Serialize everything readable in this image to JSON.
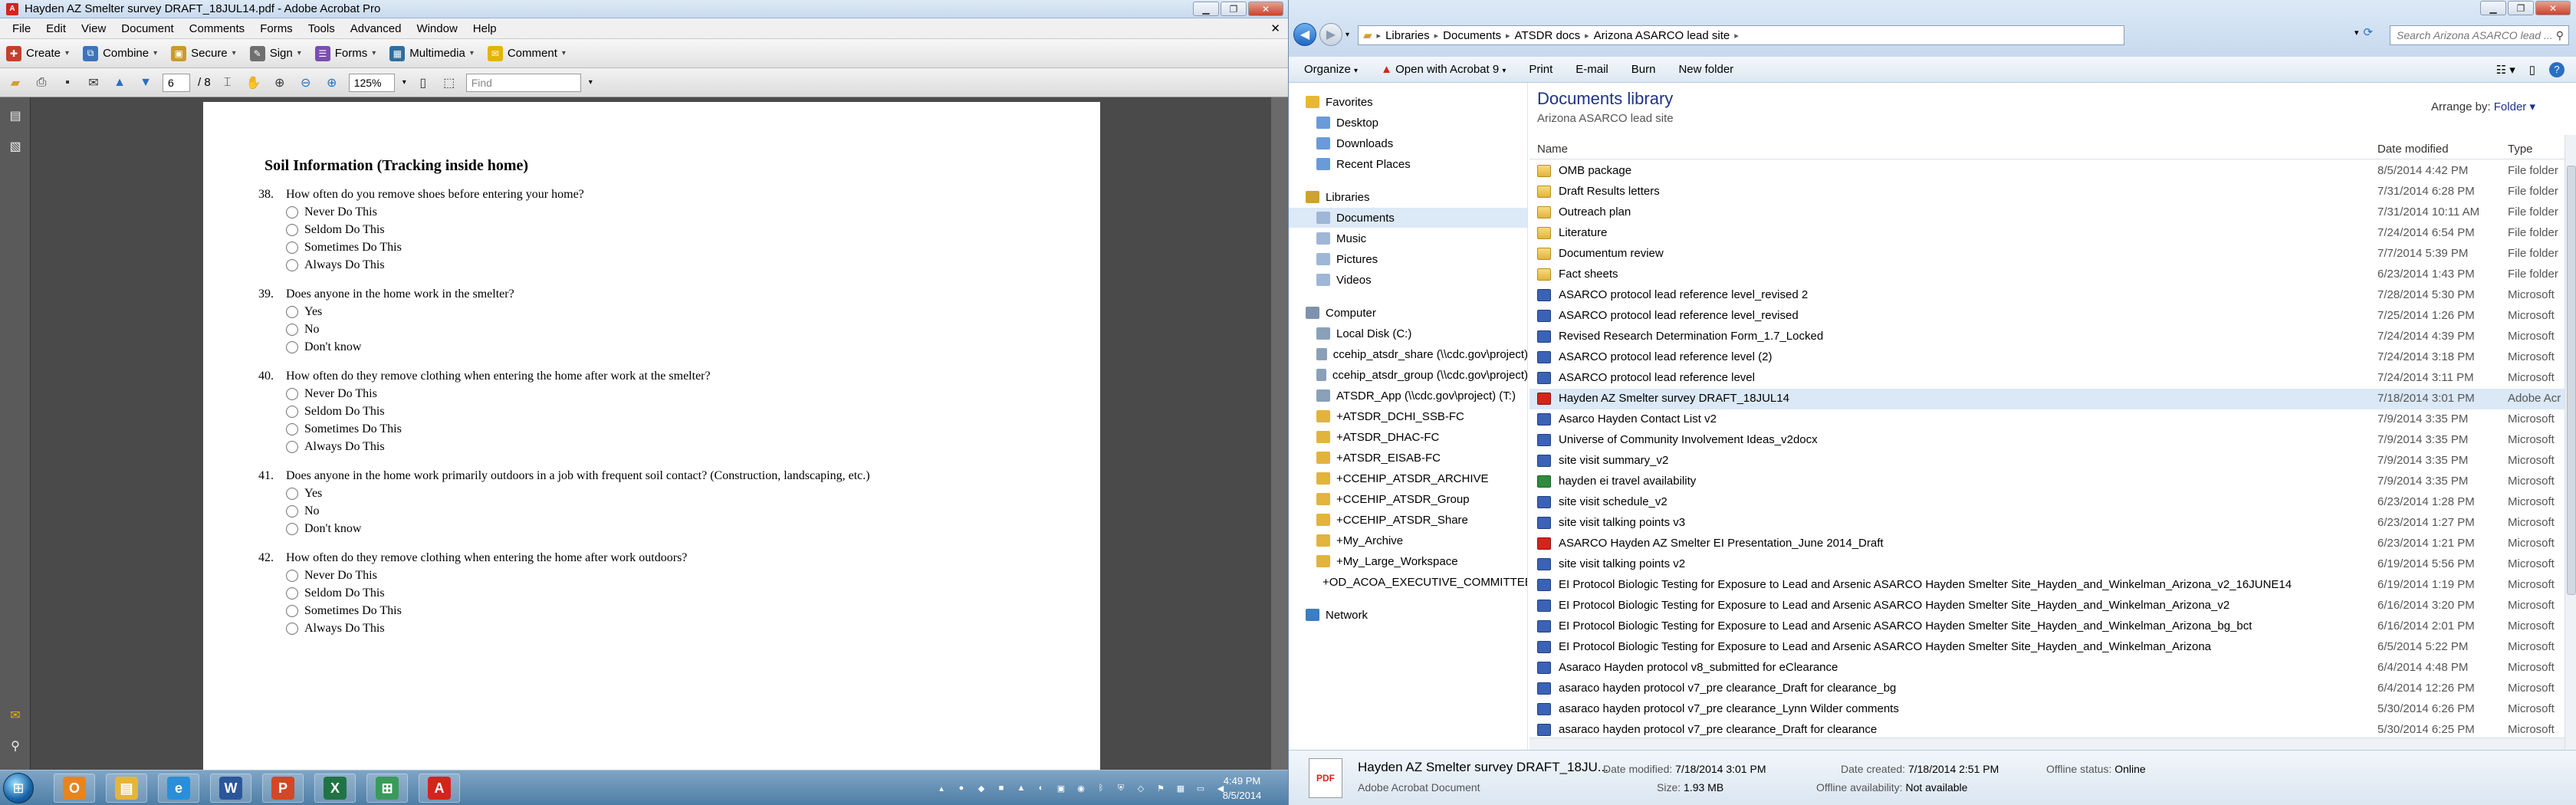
{
  "acrobat": {
    "title": "Hayden AZ Smelter survey DRAFT_18JUL14.pdf - Adobe Acrobat Pro",
    "menu": [
      "File",
      "Edit",
      "View",
      "Document",
      "Comments",
      "Forms",
      "Tools",
      "Advanced",
      "Window",
      "Help"
    ],
    "toolbar1": {
      "create": "Create",
      "combine": "Combine",
      "secure": "Secure",
      "sign": "Sign",
      "forms": "Forms",
      "multimedia": "Multimedia",
      "comment": "Comment"
    },
    "toolbar2": {
      "page": "6",
      "page_total": "/ 8",
      "zoom": "125%",
      "find_placeholder": "Find"
    },
    "document": {
      "heading": "Soil Information (Tracking inside home)",
      "questions": [
        {
          "num": "38.",
          "text": "How often do you remove shoes before entering your home?",
          "options": [
            "Never Do This",
            "Seldom Do This",
            "Sometimes Do This",
            "Always Do This"
          ]
        },
        {
          "num": "39.",
          "text": "Does anyone in the home work in the smelter?",
          "options": [
            "Yes",
            "No",
            "Don't know"
          ]
        },
        {
          "num": "40.",
          "text": "How often do they remove clothing when entering the home after work at the smelter?",
          "options": [
            "Never Do This",
            "Seldom Do This",
            "Sometimes Do This",
            "Always Do This"
          ]
        },
        {
          "num": "41.",
          "text": "Does anyone in the home work primarily outdoors in a job with frequent soil contact? (Construction, landscaping, etc.)",
          "options": [
            "Yes",
            "No",
            "Don't know"
          ]
        },
        {
          "num": "42.",
          "text": "How often do they remove clothing when entering the home after work outdoors?",
          "options": [
            "Never Do This",
            "Seldom Do This",
            "Sometimes Do This",
            "Always Do This"
          ]
        }
      ]
    }
  },
  "taskbar": {
    "apps": [
      {
        "name": "outlook",
        "glyph": "O",
        "color": "#e8841c"
      },
      {
        "name": "explorer",
        "glyph": "▤",
        "color": "#e3b63b"
      },
      {
        "name": "ie",
        "glyph": "e",
        "color": "#2a8fd8"
      },
      {
        "name": "word",
        "glyph": "W",
        "color": "#2b579a"
      },
      {
        "name": "powerpoint",
        "glyph": "P",
        "color": "#d24726"
      },
      {
        "name": "excel",
        "glyph": "X",
        "color": "#217346"
      },
      {
        "name": "network",
        "glyph": "⊞",
        "color": "#3a9a5b"
      },
      {
        "name": "acrobat",
        "glyph": "A",
        "color": "#d4241c"
      }
    ],
    "clock": {
      "time": "4:49 PM",
      "date": "8/5/2014"
    }
  },
  "explorer": {
    "address": [
      "Libraries",
      "Documents",
      "ATSDR docs",
      "Arizona ASARCO lead site"
    ],
    "search_placeholder": "Search Arizona ASARCO lead ...",
    "commands": {
      "organize": "Organize",
      "open_with": "Open with Acrobat 9",
      "print": "Print",
      "email": "E-mail",
      "burn": "Burn",
      "new_folder": "New folder"
    },
    "nav": {
      "favorites_header": "Favorites",
      "favorites": [
        "Desktop",
        "Downloads",
        "Recent Places"
      ],
      "libraries_header": "Libraries",
      "libraries": [
        "Documents",
        "Music",
        "Pictures",
        "Videos"
      ],
      "computer_header": "Computer",
      "computer": [
        "Local Disk (C:)",
        "ccehip_atsdr_share (\\\\cdc.gov\\project)",
        "ccehip_atsdr_group (\\\\cdc.gov\\project)",
        "ATSDR_App (\\\\cdc.gov\\project) (T:)",
        "+ATSDR_DCHI_SSB-FC",
        "+ATSDR_DHAC-FC",
        "+ATSDR_EISAB-FC",
        "+CCEHIP_ATSDR_ARCHIVE",
        "+CCEHIP_ATSDR_Group",
        "+CCEHIP_ATSDR_Share",
        "+My_Archive",
        "+My_Large_Workspace",
        "+OD_ACOA_EXECUTIVE_COMMITTEE-"
      ],
      "network_header": "Network"
    },
    "library": {
      "title": "Documents library",
      "subtitle": "Arizona ASARCO lead site",
      "arrange_label": "Arrange by:",
      "arrange_value": "Folder"
    },
    "columns": {
      "name": "Name",
      "date": "Date modified",
      "type": "Type"
    },
    "files": [
      {
        "name": "OMB package",
        "date": "8/5/2014 4:42 PM",
        "type": "File folder",
        "kind": "folder"
      },
      {
        "name": "Draft Results letters",
        "date": "7/31/2014 6:28 PM",
        "type": "File folder",
        "kind": "folder"
      },
      {
        "name": "Outreach plan",
        "date": "7/31/2014 10:11 AM",
        "type": "File folder",
        "kind": "folder"
      },
      {
        "name": "Literature",
        "date": "7/24/2014 6:54 PM",
        "type": "File folder",
        "kind": "folder"
      },
      {
        "name": "Documentum review",
        "date": "7/7/2014 5:39 PM",
        "type": "File folder",
        "kind": "folder"
      },
      {
        "name": "Fact sheets",
        "date": "6/23/2014 1:43 PM",
        "type": "File folder",
        "kind": "folder"
      },
      {
        "name": "ASARCO protocol lead reference level_revised 2",
        "date": "7/28/2014 5:30 PM",
        "type": "Microsoft",
        "kind": "word"
      },
      {
        "name": "ASARCO protocol lead reference level_revised",
        "date": "7/25/2014 1:26 PM",
        "type": "Microsoft",
        "kind": "word"
      },
      {
        "name": "Revised Research Determination Form_1.7_Locked",
        "date": "7/24/2014 4:39 PM",
        "type": "Microsoft",
        "kind": "word"
      },
      {
        "name": "ASARCO protocol lead reference level (2)",
        "date": "7/24/2014 3:18 PM",
        "type": "Microsoft",
        "kind": "word"
      },
      {
        "name": "ASARCO protocol lead reference level",
        "date": "7/24/2014 3:11 PM",
        "type": "Microsoft",
        "kind": "word"
      },
      {
        "name": "Hayden AZ Smelter survey DRAFT_18JUL14",
        "date": "7/18/2014 3:01 PM",
        "type": "Adobe Acr",
        "kind": "pdf",
        "selected": true
      },
      {
        "name": "Asarco Hayden Contact List v2",
        "date": "7/9/2014 3:35 PM",
        "type": "Microsoft",
        "kind": "word"
      },
      {
        "name": "Universe of Community Involvement Ideas_v2docx",
        "date": "7/9/2014 3:35 PM",
        "type": "Microsoft",
        "kind": "word"
      },
      {
        "name": "site visit summary_v2",
        "date": "7/9/2014 3:35 PM",
        "type": "Microsoft",
        "kind": "word"
      },
      {
        "name": "hayden ei travel availability",
        "date": "7/9/2014 3:35 PM",
        "type": "Microsoft",
        "kind": "excel"
      },
      {
        "name": "site visit schedule_v2",
        "date": "6/23/2014 1:28 PM",
        "type": "Microsoft",
        "kind": "word"
      },
      {
        "name": "site visit talking points v3",
        "date": "6/23/2014 1:27 PM",
        "type": "Microsoft",
        "kind": "word"
      },
      {
        "name": "ASARCO Hayden AZ Smelter EI Presentation_June 2014_Draft",
        "date": "6/23/2014 1:21 PM",
        "type": "Microsoft",
        "kind": "pdf"
      },
      {
        "name": "site visit talking points v2",
        "date": "6/19/2014 5:56 PM",
        "type": "Microsoft",
        "kind": "word"
      },
      {
        "name": "EI Protocol Biologic Testing for Exposure to Lead and Arsenic ASARCO Hayden Smelter Site_Hayden_and_Winkelman_Arizona_v2_16JUNE14",
        "date": "6/19/2014 1:19 PM",
        "type": "Microsoft",
        "kind": "word"
      },
      {
        "name": "EI Protocol Biologic Testing for Exposure to Lead and Arsenic ASARCO Hayden Smelter Site_Hayden_and_Winkelman_Arizona_v2",
        "date": "6/16/2014 3:20 PM",
        "type": "Microsoft",
        "kind": "word"
      },
      {
        "name": "EI Protocol Biologic Testing for Exposure to Lead and Arsenic ASARCO Hayden Smelter Site_Hayden_and_Winkelman_Arizona_bg_bct",
        "date": "6/16/2014 2:01 PM",
        "type": "Microsoft",
        "kind": "word"
      },
      {
        "name": "EI Protocol Biologic Testing for Exposure to Lead and Arsenic ASARCO Hayden Smelter Site_Hayden_and_Winkelman_Arizona",
        "date": "6/5/2014 5:22 PM",
        "type": "Microsoft",
        "kind": "word"
      },
      {
        "name": "Asaraco Hayden protocol v8_submitted for eClearance",
        "date": "6/4/2014 4:48 PM",
        "type": "Microsoft",
        "kind": "word"
      },
      {
        "name": "asaraco hayden protocol v7_pre clearance_Draft for clearance_bg",
        "date": "6/4/2014 12:26 PM",
        "type": "Microsoft",
        "kind": "word"
      },
      {
        "name": "asaraco hayden protocol v7_pre clearance_Lynn Wilder comments",
        "date": "5/30/2014 6:26 PM",
        "type": "Microsoft",
        "kind": "word"
      },
      {
        "name": "asaraco hayden protocol v7_pre clearance_Draft for clearance",
        "date": "5/30/2014 6:25 PM",
        "type": "Microsoft",
        "kind": "word"
      }
    ],
    "details": {
      "name": "Hayden AZ Smelter survey DRAFT_18JU...",
      "kind": "Adobe Acrobat Document",
      "date_modified_label": "Date modified:",
      "date_modified": "7/18/2014 3:01 PM",
      "size_label": "Size:",
      "size": "1.93 MB",
      "date_created_label": "Date created:",
      "date_created": "7/18/2014 2:51 PM",
      "offline_avail_label": "Offline availability:",
      "offline_avail": "Not available",
      "offline_status_label": "Offline status:",
      "offline_status": "Online"
    }
  }
}
